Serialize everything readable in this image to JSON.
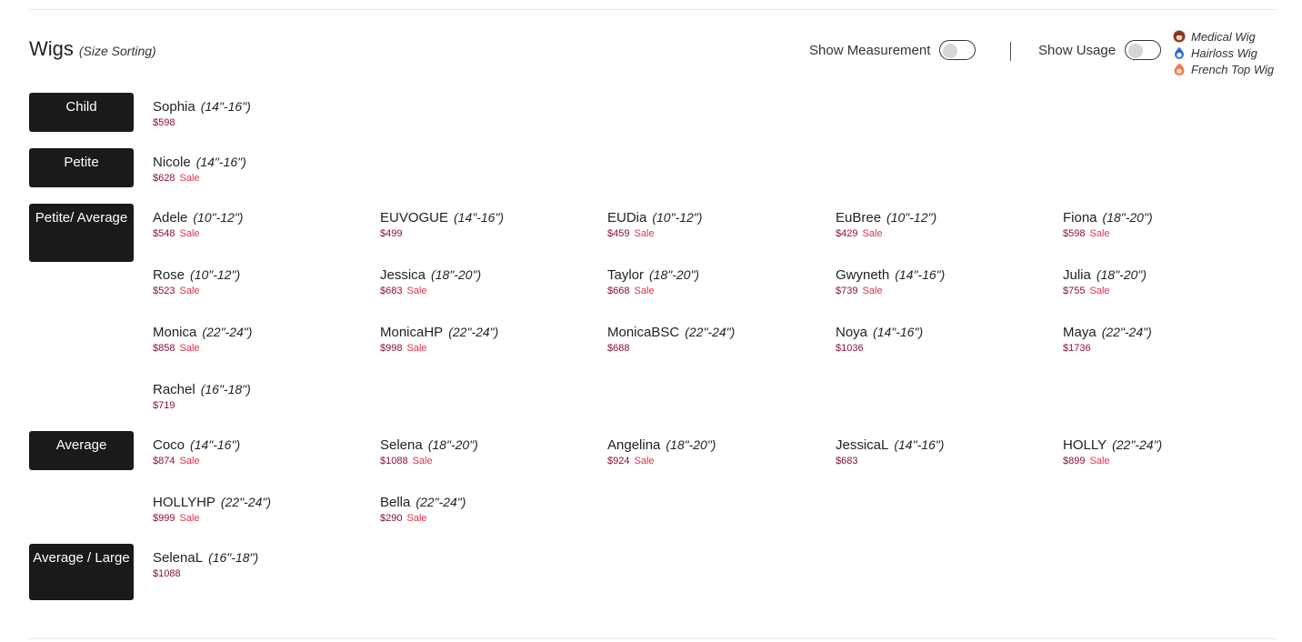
{
  "header": {
    "title": "Wigs",
    "subtitle": "(Size Sorting)"
  },
  "controls": {
    "measurement_label": "Show Measurement",
    "usage_label": "Show Usage"
  },
  "legend": [
    {
      "label": "Medical Wig",
      "icon": "medical-wig-icon",
      "color": "#8b3a1f"
    },
    {
      "label": "Hairloss Wig",
      "icon": "hairloss-wig-icon",
      "color": "#2c6fd6"
    },
    {
      "label": "French Top Wig",
      "icon": "french-top-wig-icon",
      "color": "#f07a4b"
    }
  ],
  "colors": {
    "category_bg": "#1a1a1a",
    "price": "#8a0f3d",
    "sale": "#e0304b"
  },
  "categories": [
    {
      "label": "Child",
      "products": [
        {
          "name": "Sophia",
          "size": "(14\"-16\")",
          "price": "$598",
          "sale": ""
        }
      ]
    },
    {
      "label": "Petite",
      "products": [
        {
          "name": "Nicole",
          "size": "(14\"-16\")",
          "price": "$628",
          "sale": "Sale"
        }
      ]
    },
    {
      "label": "Petite/ Average",
      "products": [
        {
          "name": "Adele",
          "size": "(10\"-12\")",
          "price": "$548",
          "sale": "Sale"
        },
        {
          "name": "EUVOGUE",
          "size": "(14\"-16\")",
          "price": "$499",
          "sale": ""
        },
        {
          "name": "EUDia",
          "size": "(10\"-12\")",
          "price": "$459",
          "sale": "Sale"
        },
        {
          "name": "EuBree",
          "size": "(10\"-12\")",
          "price": "$429",
          "sale": "Sale"
        },
        {
          "name": "Fiona",
          "size": "(18\"-20\")",
          "price": "$598",
          "sale": "Sale"
        },
        {
          "name": "Rose",
          "size": "(10\"-12\")",
          "price": "$523",
          "sale": "Sale"
        },
        {
          "name": "Jessica",
          "size": "(18\"-20\")",
          "price": "$683",
          "sale": "Sale"
        },
        {
          "name": "Taylor",
          "size": "(18\"-20\")",
          "price": "$668",
          "sale": "Sale"
        },
        {
          "name": "Gwyneth",
          "size": "(14\"-16\")",
          "price": "$739",
          "sale": "Sale"
        },
        {
          "name": "Julia",
          "size": "(18\"-20\")",
          "price": "$755",
          "sale": "Sale"
        },
        {
          "name": "Monica",
          "size": "(22\"-24\")",
          "price": "$858",
          "sale": "Sale"
        },
        {
          "name": "MonicaHP",
          "size": "(22\"-24\")",
          "price": "$998",
          "sale": "Sale"
        },
        {
          "name": "MonicaBSC",
          "size": "(22\"-24\")",
          "price": "$688",
          "sale": ""
        },
        {
          "name": "Noya",
          "size": "(14\"-16\")",
          "price": "$1036",
          "sale": ""
        },
        {
          "name": "Maya",
          "size": "(22\"-24\")",
          "price": "$1736",
          "sale": ""
        },
        {
          "name": "Rachel",
          "size": "(16\"-18\")",
          "price": "$719",
          "sale": ""
        }
      ]
    },
    {
      "label": "Average",
      "products": [
        {
          "name": "Coco",
          "size": "(14\"-16\")",
          "price": "$874",
          "sale": "Sale"
        },
        {
          "name": "Selena",
          "size": "(18\"-20\")",
          "price": "$1088",
          "sale": "Sale"
        },
        {
          "name": "Angelina",
          "size": "(18\"-20\")",
          "price": "$924",
          "sale": "Sale"
        },
        {
          "name": "JessicaL",
          "size": "(14\"-16\")",
          "price": "$683",
          "sale": ""
        },
        {
          "name": "HOLLY",
          "size": "(22\"-24\")",
          "price": "$899",
          "sale": "Sale"
        },
        {
          "name": "HOLLYHP",
          "size": "(22\"-24\")",
          "price": "$999",
          "sale": "Sale"
        },
        {
          "name": "Bella",
          "size": "(22\"-24\")",
          "price": "$290",
          "sale": "Sale"
        }
      ]
    },
    {
      "label": "Average / Large",
      "products": [
        {
          "name": "SelenaL",
          "size": "(16\"-18\")",
          "price": "$1088",
          "sale": ""
        }
      ]
    }
  ]
}
